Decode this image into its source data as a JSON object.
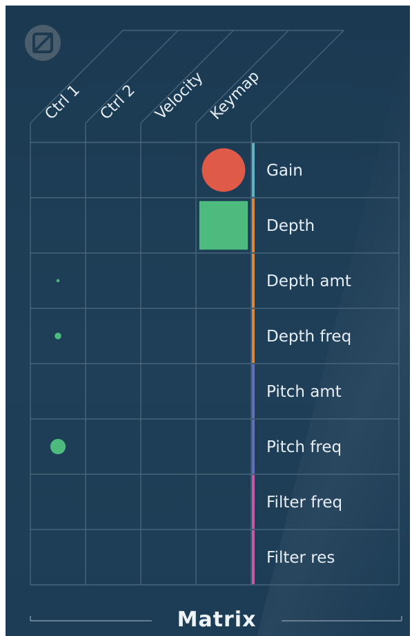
{
  "title": "Matrix",
  "power_icon": "power-off-icon",
  "columns": [
    "Ctrl 1",
    "Ctrl 2",
    "Velocity",
    "Keymap"
  ],
  "rows": [
    {
      "label": "Gain",
      "group_color": "#5fb2c4"
    },
    {
      "label": "Depth",
      "group_color": "#d8883a"
    },
    {
      "label": "Depth amt",
      "group_color": "#d8883a"
    },
    {
      "label": "Depth freq",
      "group_color": "#d8883a"
    },
    {
      "label": "Pitch amt",
      "group_color": "#5f6fbe"
    },
    {
      "label": "Pitch freq",
      "group_color": "#5f6fbe"
    },
    {
      "label": "Filter freq",
      "group_color": "#c45aa6"
    },
    {
      "label": "Filter res",
      "group_color": "#c45aa6"
    }
  ],
  "cells": [
    {
      "row": 0,
      "col": 3,
      "shape": "circle",
      "color": "#e05a48",
      "level": 0.85
    },
    {
      "row": 1,
      "col": 3,
      "shape": "square",
      "color": "#4dbb7e",
      "level": 0.95
    },
    {
      "row": 2,
      "col": 0,
      "shape": "circle",
      "color": "#4dbb7e",
      "level": 0.06
    },
    {
      "row": 3,
      "col": 0,
      "shape": "circle",
      "color": "#4dbb7e",
      "level": 0.13
    },
    {
      "row": 5,
      "col": 0,
      "shape": "circle",
      "color": "#4dbb7e",
      "level": 0.3
    }
  ],
  "colors": {
    "background": "#1e3d56",
    "grid": "#4f6b80",
    "text": "#e6eef4"
  }
}
